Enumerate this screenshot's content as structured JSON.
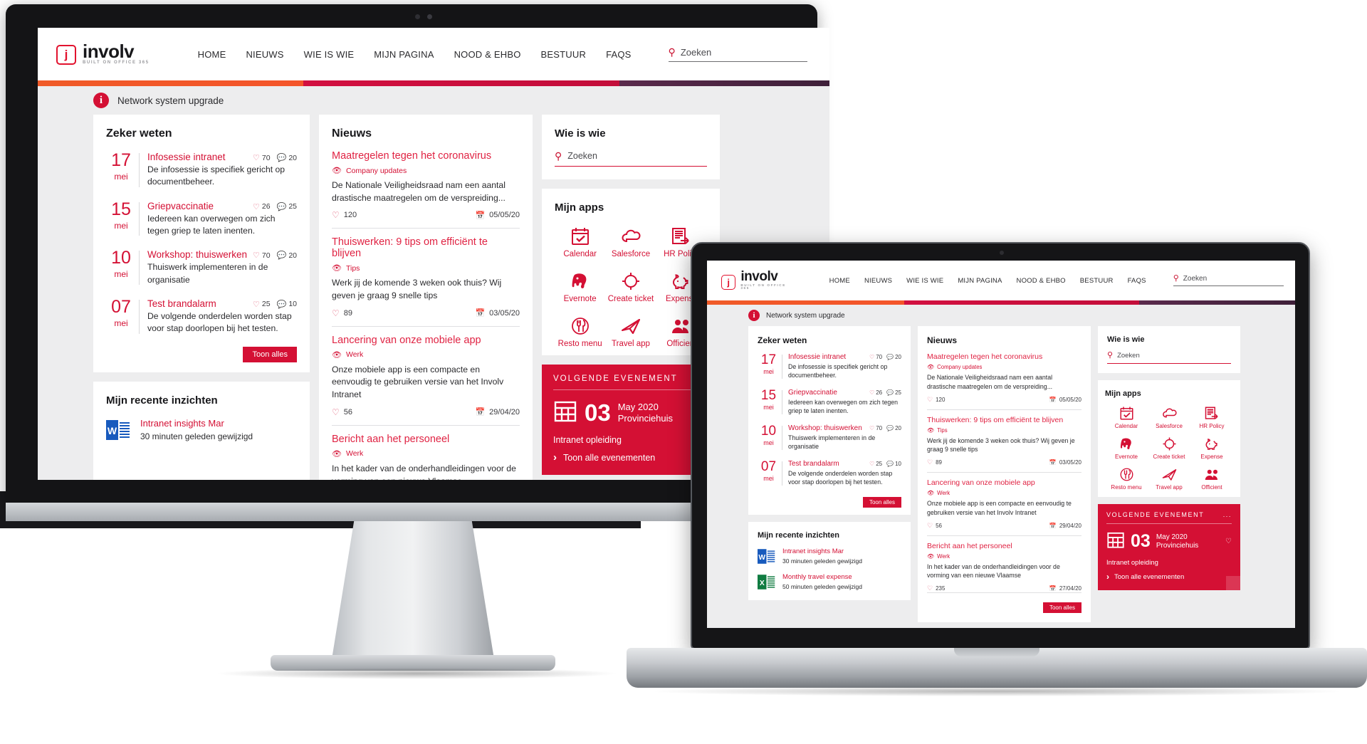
{
  "brand": {
    "name": "involv",
    "tagline": "BUILT ON OFFICE 365",
    "mark_letter": "j",
    "accent": "#D41034",
    "accent_link": "#E02343",
    "bar_orange": "#F4562A",
    "bar_crimson": "#D0103A",
    "bar_purple": "#4A2545"
  },
  "nav": {
    "items": [
      {
        "label": "HOME"
      },
      {
        "label": "NIEUWS"
      },
      {
        "label": "WIE IS WIE"
      },
      {
        "label": "MIJN PAGINA"
      },
      {
        "label": "NOOD & EHBO"
      },
      {
        "label": "BESTUUR"
      },
      {
        "label": "FAQS"
      }
    ]
  },
  "header_search": {
    "placeholder": "Zoeken",
    "icon": "search-icon"
  },
  "notice": {
    "icon": "info-icon",
    "text": "Network system upgrade"
  },
  "zeker_weten": {
    "title": "Zeker weten",
    "show_all": "Toon alles",
    "items": [
      {
        "day": "17",
        "month": "mei",
        "title": "Infosessie intranet",
        "desc": "De infosessie is specifiek gericht op documentbeheer.",
        "likes": "70",
        "comments": "20"
      },
      {
        "day": "15",
        "month": "mei",
        "title": "Griepvaccinatie",
        "desc": "Iedereen kan overwegen om zich tegen griep te laten inenten.",
        "likes": "26",
        "comments": "25"
      },
      {
        "day": "10",
        "month": "mei",
        "title": "Workshop: thuiswerken",
        "desc": "Thuiswerk implementeren in de organisatie",
        "likes": "70",
        "comments": "20"
      },
      {
        "day": "07",
        "month": "mei",
        "title": "Test brandalarm",
        "desc": "De volgende onderdelen worden stap voor stap doorlopen bij het testen.",
        "likes": "25",
        "comments": "10"
      }
    ]
  },
  "nieuws": {
    "title": "Nieuws",
    "show_all": "Toon alles",
    "items": [
      {
        "title": "Maatregelen tegen het coronavirus",
        "category": "Company updates",
        "desc": "De Nationale Veiligheidsraad nam een aantal drastische maatregelen om de verspreiding...",
        "likes": "120",
        "date": "05/05/20"
      },
      {
        "title": "Thuiswerken: 9 tips om efficiënt te blijven",
        "category": "Tips",
        "desc": "Werk jij de komende 3 weken ook thuis? Wij geven je graag 9 snelle tips",
        "likes": "89",
        "date": "03/05/20"
      },
      {
        "title": "Lancering van onze mobiele app",
        "category": "Werk",
        "desc": "Onze mobiele app is een compacte en eenvoudig te gebruiken versie van het Involv Intranet",
        "likes": "56",
        "date": "29/04/20"
      },
      {
        "title": "Bericht aan het personeel",
        "category": "Werk",
        "desc": "In het kader van de onderhandleidingen voor de vorming van een nieuwe Vlaamse",
        "likes": "235",
        "date": "27/04/20"
      }
    ]
  },
  "wie_is_wie": {
    "title": "Wie is wie",
    "search_placeholder": "Zoeken"
  },
  "mijn_apps": {
    "title": "Mijn apps",
    "items": [
      {
        "label": "Calendar",
        "icon": "calendar-check-icon"
      },
      {
        "label": "Salesforce",
        "icon": "cloud-icon"
      },
      {
        "label": "HR Policy",
        "icon": "document-arrow-icon"
      },
      {
        "label": "Evernote",
        "icon": "elephant-icon"
      },
      {
        "label": "Create ticket",
        "icon": "target-icon"
      },
      {
        "label": "Expense",
        "icon": "piggy-bank-icon"
      },
      {
        "label": "Resto menu",
        "icon": "cutlery-icon"
      },
      {
        "label": "Travel app",
        "icon": "paper-plane-icon"
      },
      {
        "label": "Officient",
        "icon": "people-icon"
      }
    ]
  },
  "evenement": {
    "heading": "VOLGENDE EVENEMENT",
    "more": "...",
    "day": "03",
    "month_year": "May 2020",
    "location": "Provinciehuis",
    "subtitle": "Intranet opleiding",
    "link": "Toon alle evenementen",
    "chevron": "›"
  },
  "recente_inzichten": {
    "title": "Mijn recente inzichten",
    "items": [
      {
        "file_letter": "W",
        "file_color": "#185ABD",
        "title": "Intranet insights Mar",
        "meta": "30 minuten geleden gewijzigd"
      },
      {
        "file_letter": "X",
        "file_color": "#107C41",
        "title": "Monthly travel expense",
        "meta": "50 minuten geleden gewijzigd"
      }
    ]
  }
}
